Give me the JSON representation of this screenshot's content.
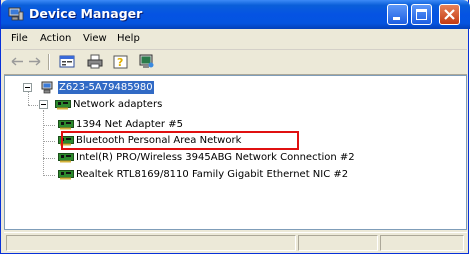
{
  "window": {
    "title": "Device Manager",
    "title_icon": "device-manager-icon"
  },
  "menu": {
    "items": [
      "File",
      "Action",
      "View",
      "Help"
    ]
  },
  "toolbar": {
    "buttons": [
      "back-arrow-icon",
      "forward-arrow-icon",
      "properties-icon",
      "print-icon",
      "help-icon",
      "scan-hardware-icon"
    ]
  },
  "tree": {
    "root": "Z623-5A79485980",
    "category": "Network adapters",
    "devices": [
      "1394 Net Adapter #5",
      "Bluetooth Personal Area Network",
      "Intel(R) PRO/Wireless 3945ABG Network Connection #2",
      "Realtek RTL8169/8110 Family Gigabit Ethernet NIC #2"
    ]
  },
  "colors": {
    "titlebar": "#0454e0",
    "selection": "#316ac5",
    "highlight_box": "#e01010"
  }
}
